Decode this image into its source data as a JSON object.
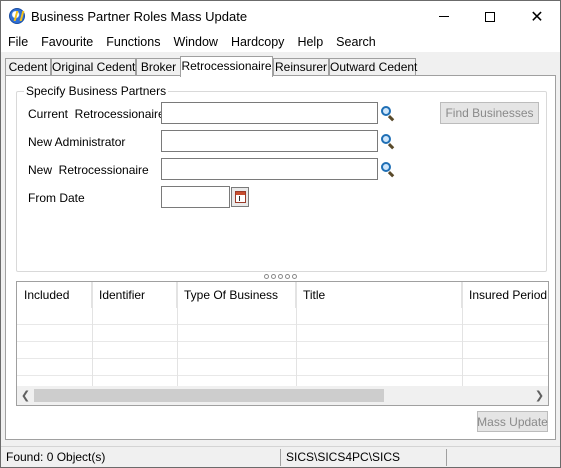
{
  "window": {
    "title": "Business Partner Roles Mass Update",
    "controls": {
      "minimize": "–",
      "maximize": "□",
      "close": "✕"
    }
  },
  "menu": [
    "File",
    "Favourite",
    "Functions",
    "Window",
    "Hardcopy",
    "Help",
    "Search"
  ],
  "tabs": [
    {
      "label": "Cedent",
      "active": false
    },
    {
      "label": "Original Cedent",
      "active": false
    },
    {
      "label": "Broker",
      "active": false
    },
    {
      "label": "Retrocessionaire",
      "active": true
    },
    {
      "label": "Reinsurer",
      "active": false
    },
    {
      "label": "Outward Cedent",
      "active": false
    }
  ],
  "specify": {
    "legend": "Specify Business Partners",
    "current_retro_label": "Current  Retrocessionaire",
    "current_retro_value": "",
    "new_admin_label": "New Administrator",
    "new_admin_value": "",
    "new_retro_label": "New  Retrocessionaire",
    "new_retro_value": "",
    "from_date_label": "From Date",
    "from_date_value": "",
    "find_button": "Find Businesses"
  },
  "grid": {
    "columns": [
      "Included",
      "Identifier",
      "Type Of Business",
      "Title",
      "Insured Period"
    ],
    "rows": [],
    "scroll_left_glyph": "❮",
    "scroll_right_glyph": "❯"
  },
  "actions": {
    "mass_update": "Mass Update"
  },
  "status": {
    "found": "Found: 0 Object(s)",
    "path": "SICS\\SICS4PC\\SICS"
  },
  "icons": {
    "app": "app-logo-icon",
    "lookup": "magnifier-icon",
    "calendar": "calendar-icon"
  }
}
